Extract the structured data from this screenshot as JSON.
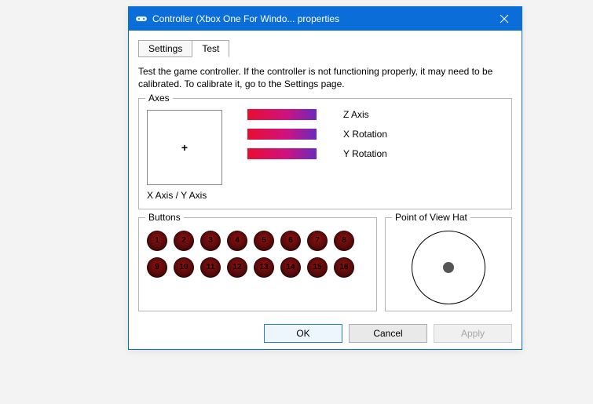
{
  "window": {
    "title": "Controller (Xbox One For Windo... properties",
    "icon": "game-controller-icon"
  },
  "tabs": {
    "settings": "Settings",
    "test": "Test",
    "active": "test"
  },
  "instruction": "Test the game controller.  If the controller is not functioning properly, it may need to be calibrated.  To calibrate it, go to the Settings page.",
  "axes": {
    "legend": "Axes",
    "xy_label": "X Axis / Y Axis",
    "xy_marker": "+",
    "bars": [
      {
        "label": "Z Axis"
      },
      {
        "label": "X Rotation"
      },
      {
        "label": "Y Rotation"
      }
    ]
  },
  "buttons_group": {
    "legend": "Buttons",
    "buttons": [
      "1",
      "2",
      "3",
      "4",
      "5",
      "6",
      "7",
      "8",
      "9",
      "10",
      "11",
      "12",
      "13",
      "14",
      "15",
      "16"
    ]
  },
  "pov": {
    "legend": "Point of View Hat"
  },
  "footer": {
    "ok": "OK",
    "cancel": "Cancel",
    "apply": "Apply"
  }
}
